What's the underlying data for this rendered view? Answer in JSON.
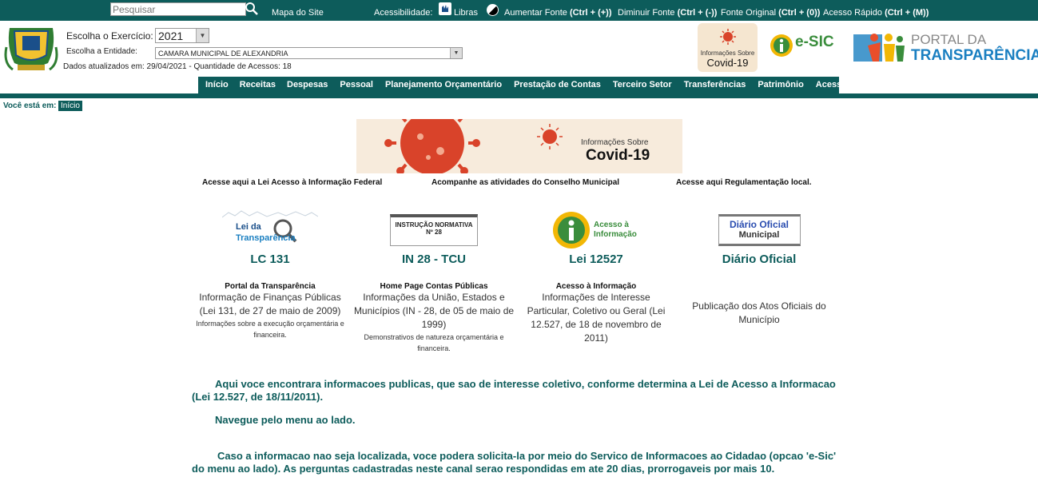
{
  "topbar": {
    "search_placeholder": "Pesquisar",
    "sitemap": "Mapa do Site",
    "accessibility": "Acessibilidade:",
    "libras": "Libras",
    "increase_font": "Aumentar Fonte",
    "increase_font_shortcut": "(Ctrl + (+))",
    "decrease_font": "Diminuir Fonte",
    "decrease_font_shortcut": "(Ctrl + (-))",
    "original_font": "Fonte Original",
    "original_font_shortcut": "(Ctrl + (0))",
    "quick_access": "Acesso Rápido",
    "quick_access_shortcut": "(Ctrl + (M))"
  },
  "header": {
    "exercise_label": "Escolha o Exercício:",
    "exercise_value": "2021",
    "entity_label": "Escolha a Entidade:",
    "entity_value": "CAMARA MUNICIPAL DE ALEXANDRIA",
    "updated_info": "Dados atualizados em: 29/04/2021 - Quantidade de Acessos: 18",
    "covid_badge_line1": "Informações Sobre",
    "covid_badge_line2": "Covid-19",
    "esic_text": "e-SIC",
    "portal_line1": "PORTAL DA",
    "portal_line2": "TRANSPARÊNCIA"
  },
  "nav": {
    "items": [
      "Início",
      "Receitas",
      "Despesas",
      "Pessoal",
      "Planejamento Orçamentário",
      "Prestação de Contas",
      "Terceiro Setor",
      "Transferências",
      "Patrimônio",
      "Acesso à Informação"
    ]
  },
  "breadcrumb": {
    "label": "Você está em:",
    "current": "Início"
  },
  "banner": {
    "line1": "Informações Sobre",
    "line2": "Covid-19"
  },
  "quicklinks": [
    "Acesse aqui a Lei Acesso à Informação Federal",
    "Acompanhe as atividades do Conselho Municipal",
    "Acesse aqui Regulamentação local."
  ],
  "cards": [
    {
      "logo_line1": "Lei da",
      "logo_line2": "Transparência",
      "title": "LC 131",
      "subtitle": "Portal da Transparência",
      "desc": "Informação de Finanças Públicas (Lei 131, de 27 de maio de 2009)",
      "small": "Informações sobre a execução orçamentária e financeira."
    },
    {
      "logo_line1": "INSTRUÇÃO NORMATIVA",
      "logo_line2": "Nº 28",
      "title": "IN 28 - TCU",
      "subtitle": "Home Page Contas Públicas",
      "desc": "Informações da União, Estados e Municípios (IN - 28, de 05 de maio de 1999)",
      "small": "Demonstrativos de natureza orçamentária e financeira."
    },
    {
      "logo_line1": "Acesso à",
      "logo_line2": "Informação",
      "title": "Lei 12527",
      "subtitle": "Acesso à Informação",
      "desc": "Informações de Interesse Particular, Coletivo ou Geral (Lei 12.527, de 18 de novembro de 2011)",
      "small": ""
    },
    {
      "logo_line1": "Diário Oficial",
      "logo_line2": "Municipal",
      "title": "Diário Oficial",
      "subtitle": "",
      "desc": "Publicação dos Atos Oficiais do Município",
      "small": ""
    }
  ],
  "body": {
    "p1": "Aqui voce encontrara informacoes publicas, que sao de interesse coletivo, conforme determina a Lei de Acesso a Informacao (Lei 12.527, de 18/11/2011).",
    "p2": "Navegue pelo menu ao lado.",
    "p3": "Caso a informacao nao seja localizada, voce podera solicita-la por meio do Servico de Informacoes ao Cidadao (opcao 'e-Sic' do menu ao lado). As perguntas cadastradas neste canal serao respondidas em ate 20 dias, prorrogaveis por mais 10."
  },
  "colors": {
    "primary": "#0d5c5b",
    "covid_red": "#d9432a",
    "esic_yellow": "#f2b705",
    "portal_blue": "#1a7fc1"
  }
}
